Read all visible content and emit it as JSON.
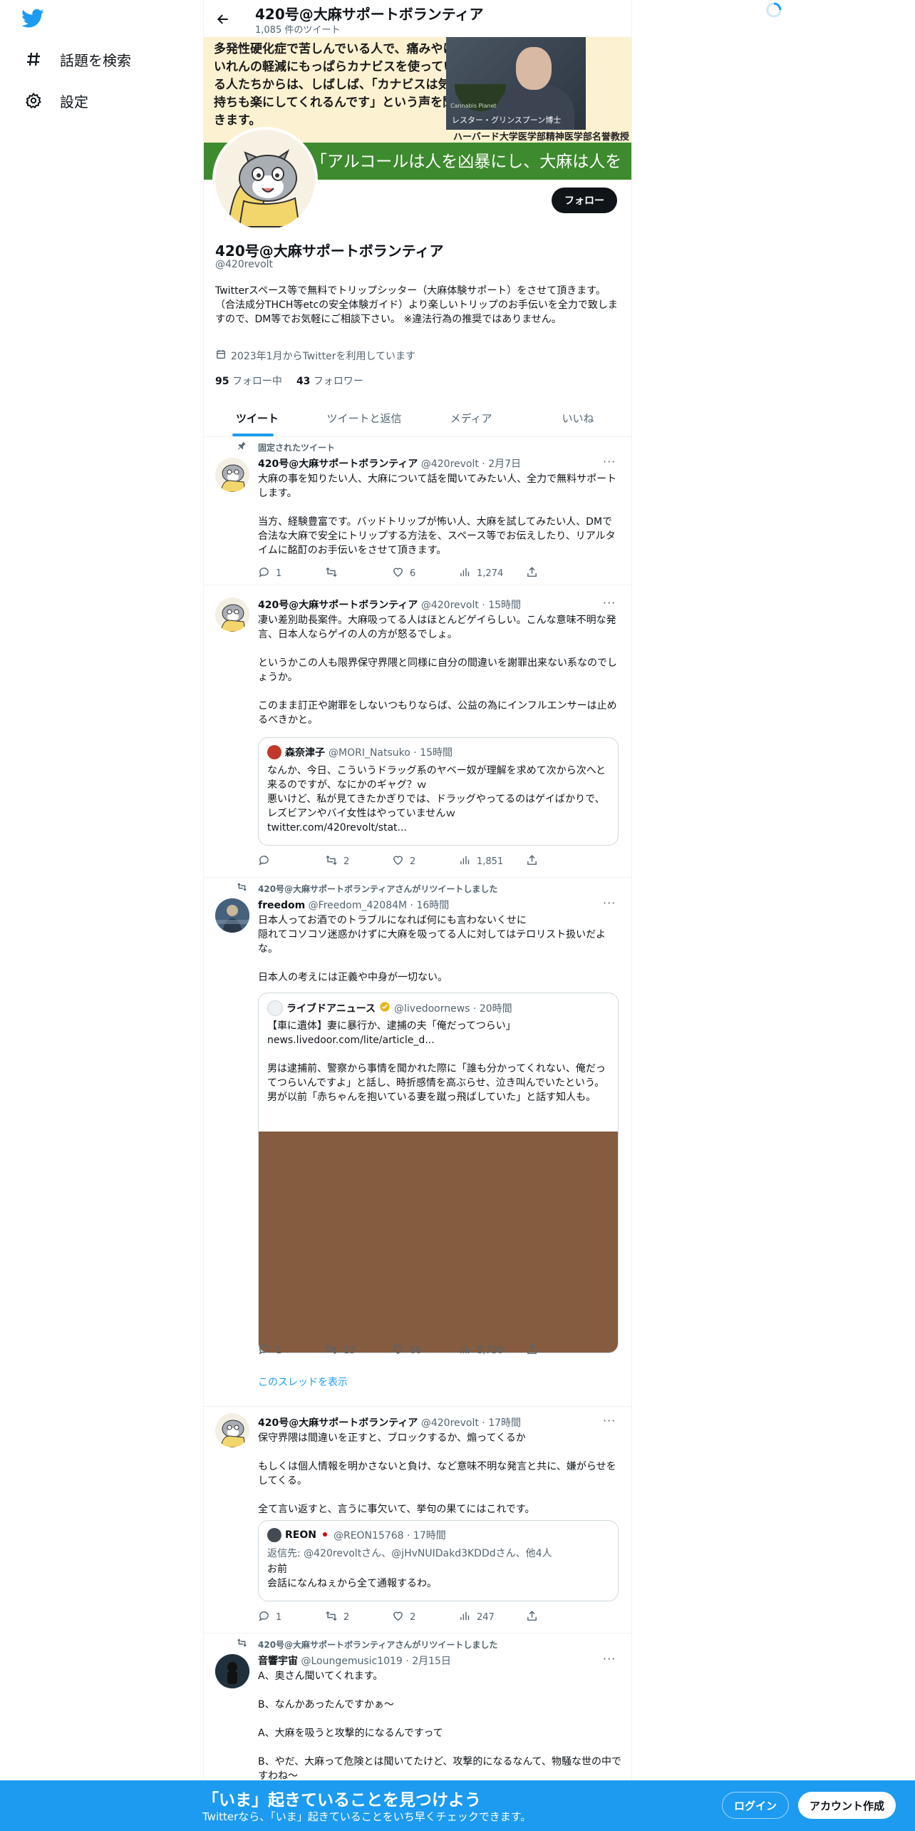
{
  "nav": {
    "explore_label": "話題を検索",
    "settings_label": "設定"
  },
  "header": {
    "title": "420号@大麻サポートボランティア",
    "tweet_count": "1,085 件のツイート"
  },
  "banner": {
    "text": "多発性硬化症で苦しんでいる人で、痛みやけいれんの軽減にもっぱらカナビスを使っている人たちからは、しばしば、「カナビスは気持ちも楽にしてくれるんです」という声を聞きます。",
    "photo_caption": "レスター・グリンスプーン博士",
    "photo_sub": "Cannabis Planet",
    "subtitle": "ハーバード大学医学部精神医学部名誉教授",
    "quote": "「アルコールは人を凶暴にし、大麻は人を"
  },
  "profile": {
    "follow_label": "フォロー",
    "name": "420号@大麻サポートボランティア",
    "handle": "@420revolt",
    "bio": "Twitterスペース等で無料でトリップシッター（大麻体験サポート）をさせて頂きます。（合法成分THCH等etcの安全体験ガイド）より楽しいトリップのお手伝いを全力で致しますので、DM等でお気軽にご相談下さい。 ※違法行為の推奨ではありません。",
    "joined": "2023年1月からTwitterを利用しています",
    "following_count": "95",
    "following_label": "フォロー中",
    "followers_count": "43",
    "followers_label": "フォロワー"
  },
  "tabs": [
    "ツイート",
    "ツイートと返信",
    "メディア",
    "いいね"
  ],
  "tweets": [
    {
      "social": "固定されたツイート",
      "name": "420号@大麻サポートボランティア",
      "meta": "@420revolt · 2月7日",
      "text": "大麻の事を知りたい人、大麻について話を聞いてみたい人、全力で無料サポートします。\n\n当方、経験豊富です。バッドトリップが怖い人、大麻を試してみたい人、DMで合法な大麻で安全にトリップする方法を、スペース等でお伝えしたり、リアルタイムに酩酊のお手伝いをさせて頂きます。",
      "replies": "1",
      "retweets": "",
      "likes": "6",
      "views": "1,274"
    },
    {
      "name": "420号@大麻サポートボランティア",
      "meta": "@420revolt · 15時間",
      "text": "凄い差別助長案件。大麻吸ってる人はほとんどゲイらしい。こんな意味不明な発言、日本人ならゲイの人の方が怒るでしょ。\n\nというかこの人も限界保守界隈と同様に自分の間違いを謝罪出来ない系なのでしょうか。\n\nこのまま訂正や謝罪をしないつもりならば、公益の為にインフルエンサーは止めるべきかと。",
      "quote": {
        "name": "森奈津子",
        "meta": "@MORI_Natsuko · 15時間",
        "text": "なんか、今日、こういうドラッグ系のヤベー奴が理解を求めて次から次へと来るのですが、なにかのギャグ？ｗ\n悪いけど、私が見てきたかぎりでは、ドラッグやってるのはゲイばかりで、レズビアンやバイ女性はやっていませんｗ\ntwitter.com/420revolt/stat..."
      },
      "replies": "",
      "retweets": "2",
      "likes": "2",
      "views": "1,851"
    },
    {
      "social": "420号@大麻サポートボランティアさんがリツイートしました",
      "name": "freedom",
      "meta": "@Freedom_42084M · 16時間",
      "text": "日本人ってお酒でのトラブルになれば何にも言わないくせに\n隠れてコソコソ迷惑かけずに大麻を吸ってる人に対してはテロリスト扱いだよな。\n\n日本人の考えには正義や中身が一切ない。",
      "quote": {
        "name": "ライブドアニュース",
        "meta": "@livedoornews · 20時間",
        "text": "【車に遺体】妻に暴行か、逮捕の夫「俺だってつらい」\nnews.livedoor.com/lite/article_d...\n\n男は逮捕前、警察から事情を聞かれた際に「誰も分かってくれない、俺だってつらいんですよ」と話し、時折感情を高ぶらせ、泣き叫んでいたという。男が以前「赤ちゃんを抱いている妻を蹴っ飛ばしていた」と話す知人も。"
      },
      "replies": "1",
      "retweets": "13",
      "likes": "66",
      "views": "8,730",
      "show_thread": "このスレッドを表示"
    },
    {
      "name": "420号@大麻サポートボランティア",
      "meta": "@420revolt · 17時間",
      "text": "保守界隈は間違いを正すと、ブロックするか、煽ってくるか\n\nもしくは個人情報を明かさないと負け、など意味不明な発言と共に、嫌がらせをしてくる。\n\n全て言い返すと、言うに事欠いて、挙句の果てにはこれです。",
      "quote": {
        "name": "REON",
        "meta": "@REON15768 · 17時間",
        "reply_to": "返信先: @420revoltさん、@jHvNUIDakd3KDDdさん、他4人",
        "text": "お前\n会話になんねぇから全て通報するわ。"
      },
      "replies": "1",
      "retweets": "2",
      "likes": "2",
      "views": "247"
    },
    {
      "social": "420号@大麻サポートボランティアさんがリツイートしました",
      "name": "音響宇宙",
      "meta": "@Loungemusic1019 · 2月15日",
      "text": "A、奥さん聞いてくれます。\n\nB、なんかあったんですかぁ〜\n\nA、大麻を吸うと攻撃的になるんですって\n\nB、やだ、大麻って危険とは聞いてたけど、攻撃的になるなんて、物騒な世の中ですわね〜"
    }
  ],
  "bottom_bar": {
    "title": "「いま」起きていることを見つけよう",
    "subtitle": "Twitterなら、「いま」起きていることをいち早くチェックできます。",
    "login_label": "ログイン",
    "signup_label": "アカウント作成"
  },
  "colors": {
    "accent": "#1d9bf0",
    "text": "#0f1419",
    "muted": "#536471",
    "banner_green": "#3e8a2e",
    "media_brown": "#855c40"
  }
}
